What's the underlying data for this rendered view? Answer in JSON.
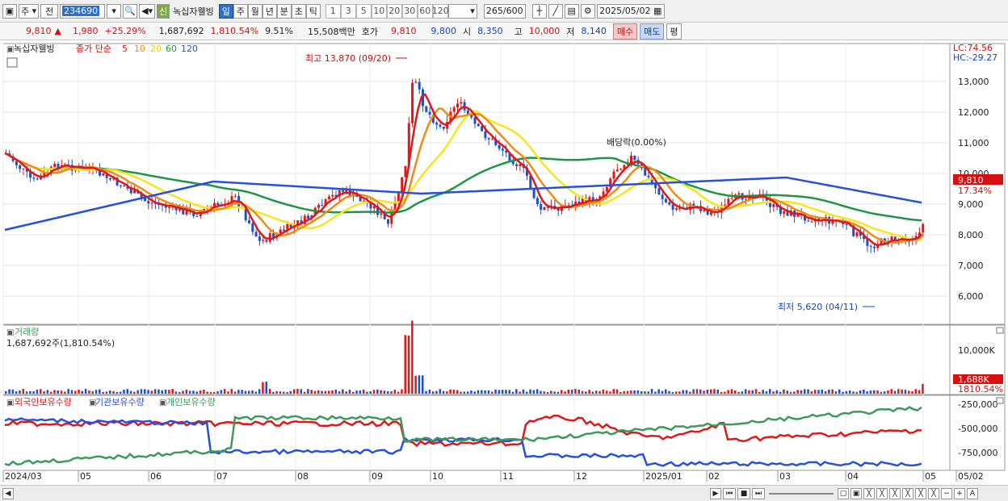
{
  "toolbar": {
    "mode": "주",
    "prev": "전",
    "code": "234690",
    "badge": "신",
    "stock_name": "녹십자웰빙",
    "periods": [
      "일",
      "주",
      "월",
      "년",
      "분",
      "초",
      "틱"
    ],
    "active_period": "일",
    "minute_units": [
      "1",
      "3",
      "5",
      "10",
      "20",
      "30",
      "60",
      "120"
    ],
    "count": "265",
    "count_total": "/600",
    "date": "2025/05/02"
  },
  "quote": {
    "price": "9,810",
    "change_arrow": "▲",
    "change": "1,980",
    "change_pct": "+25.29%",
    "volume": "1,687,692",
    "volume_ratio": "1,810.54%",
    "turnover": "9.51%",
    "amount": "15,508백만",
    "ask_label": "호가",
    "ask": "9,810",
    "bid": "9,800",
    "open_label": "시",
    "open": "8,350",
    "high_label": "고",
    "high": "10,000",
    "low_label": "저",
    "low": "8,140",
    "buy": "매수",
    "sell": "매도",
    "eval": "평"
  },
  "price_panel": {
    "legend_name": "녹십자웰빙",
    "legend_close": "종가 단순",
    "ma_labels": [
      "5",
      "10",
      "20",
      "60",
      "120"
    ],
    "lc": "LC:74.56",
    "hc": "HC:-29.27",
    "y_ticks": [
      "13,000",
      "12,000",
      "11,000",
      "10,000",
      "9,000",
      "8,000",
      "7,000",
      "6,000"
    ],
    "last_price": "9,810",
    "last_pct": "17.34%",
    "max_annotation": "최고 13,870 (09/20)",
    "min_annotation": "최저 5,620 (04/11)",
    "dividend_annotation": "배당락(0.00%)"
  },
  "volume_panel": {
    "title": "거래량",
    "subtitle": "1,687,692주(1,810.54%)",
    "y_tick": "10,000K",
    "last_value": "1,688K",
    "last_pct": "1810.54%"
  },
  "holding_panel": {
    "legend": [
      "외국인보유수량",
      "기관보유수량",
      "개인보유수량"
    ],
    "y_ticks": [
      "-250,000",
      "-500,000",
      "-750,000"
    ]
  },
  "x_axis": [
    "2024/03",
    "05",
    "06",
    "07",
    "08",
    "09",
    "10",
    "11",
    "12",
    "2025/01",
    "02",
    "03",
    "04",
    "05",
    "05/02"
  ],
  "colors": {
    "ma5": "#e01818",
    "ma10": "#f08c14",
    "ma20": "#f5e61e",
    "ma60": "#1e9646",
    "ma120": "#2850dc",
    "up_candle": "#e01818",
    "down_candle": "#1e50c8",
    "foreign": "#e01818",
    "institution": "#2850dc",
    "individual": "#3c9a5a"
  }
}
